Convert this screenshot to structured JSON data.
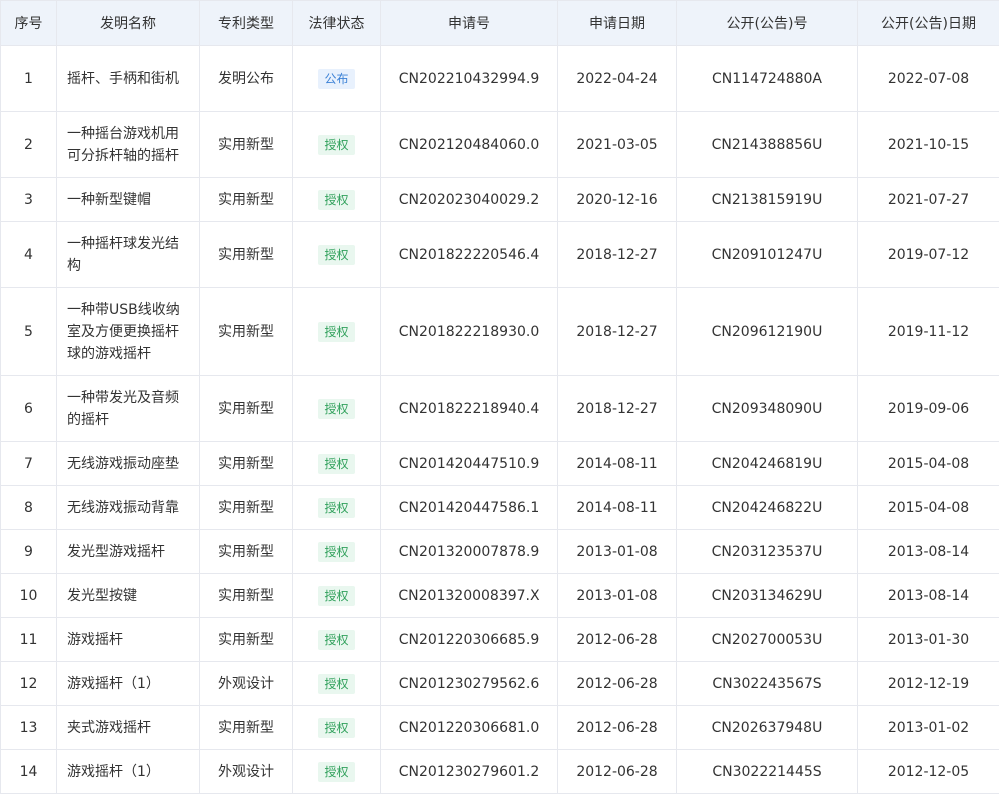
{
  "headers": [
    "序号",
    "发明名称",
    "专利类型",
    "法律状态",
    "申请号",
    "申请日期",
    "公开(公告)号",
    "公开(公告)日期"
  ],
  "rows": [
    {
      "no": "1",
      "name": "摇杆、手柄和街机",
      "type": "发明公布",
      "status": "公布",
      "status_kind": "publish",
      "app_no": "CN202210432994.9",
      "app_date": "2022-04-24",
      "pub_no": "CN114724880A",
      "pub_date": "2022-07-08"
    },
    {
      "no": "2",
      "name": "一种摇台游戏机用可分拆杆轴的摇杆",
      "type": "实用新型",
      "status": "授权",
      "status_kind": "grant",
      "app_no": "CN202120484060.0",
      "app_date": "2021-03-05",
      "pub_no": "CN214388856U",
      "pub_date": "2021-10-15"
    },
    {
      "no": "3",
      "name": "一种新型键帽",
      "type": "实用新型",
      "status": "授权",
      "status_kind": "grant",
      "app_no": "CN202023040029.2",
      "app_date": "2020-12-16",
      "pub_no": "CN213815919U",
      "pub_date": "2021-07-27"
    },
    {
      "no": "4",
      "name": "一种摇杆球发光结构",
      "type": "实用新型",
      "status": "授权",
      "status_kind": "grant",
      "app_no": "CN201822220546.4",
      "app_date": "2018-12-27",
      "pub_no": "CN209101247U",
      "pub_date": "2019-07-12"
    },
    {
      "no": "5",
      "name": "一种带USB线收纳室及方便更换摇杆球的游戏摇杆",
      "type": "实用新型",
      "status": "授权",
      "status_kind": "grant",
      "app_no": "CN201822218930.0",
      "app_date": "2018-12-27",
      "pub_no": "CN209612190U",
      "pub_date": "2019-11-12"
    },
    {
      "no": "6",
      "name": "一种带发光及音频的摇杆",
      "type": "实用新型",
      "status": "授权",
      "status_kind": "grant",
      "app_no": "CN201822218940.4",
      "app_date": "2018-12-27",
      "pub_no": "CN209348090U",
      "pub_date": "2019-09-06"
    },
    {
      "no": "7",
      "name": "无线游戏振动座垫",
      "type": "实用新型",
      "status": "授权",
      "status_kind": "grant",
      "app_no": "CN201420447510.9",
      "app_date": "2014-08-11",
      "pub_no": "CN204246819U",
      "pub_date": "2015-04-08"
    },
    {
      "no": "8",
      "name": "无线游戏振动背靠",
      "type": "实用新型",
      "status": "授权",
      "status_kind": "grant",
      "app_no": "CN201420447586.1",
      "app_date": "2014-08-11",
      "pub_no": "CN204246822U",
      "pub_date": "2015-04-08"
    },
    {
      "no": "9",
      "name": "发光型游戏摇杆",
      "type": "实用新型",
      "status": "授权",
      "status_kind": "grant",
      "app_no": "CN201320007878.9",
      "app_date": "2013-01-08",
      "pub_no": "CN203123537U",
      "pub_date": "2013-08-14"
    },
    {
      "no": "10",
      "name": "发光型按键",
      "type": "实用新型",
      "status": "授权",
      "status_kind": "grant",
      "app_no": "CN201320008397.X",
      "app_date": "2013-01-08",
      "pub_no": "CN203134629U",
      "pub_date": "2013-08-14"
    },
    {
      "no": "11",
      "name": "游戏摇杆",
      "type": "实用新型",
      "status": "授权",
      "status_kind": "grant",
      "app_no": "CN201220306685.9",
      "app_date": "2012-06-28",
      "pub_no": "CN202700053U",
      "pub_date": "2013-01-30"
    },
    {
      "no": "12",
      "name": "游戏摇杆（1）",
      "type": "外观设计",
      "status": "授权",
      "status_kind": "grant",
      "app_no": "CN201230279562.6",
      "app_date": "2012-06-28",
      "pub_no": "CN302243567S",
      "pub_date": "2012-12-19"
    },
    {
      "no": "13",
      "name": "夹式游戏摇杆",
      "type": "实用新型",
      "status": "授权",
      "status_kind": "grant",
      "app_no": "CN201220306681.0",
      "app_date": "2012-06-28",
      "pub_no": "CN202637948U",
      "pub_date": "2013-01-02"
    },
    {
      "no": "14",
      "name": "游戏摇杆（1）",
      "type": "外观设计",
      "status": "授权",
      "status_kind": "grant",
      "app_no": "CN201230279601.2",
      "app_date": "2012-06-28",
      "pub_no": "CN302221445S",
      "pub_date": "2012-12-05"
    }
  ]
}
